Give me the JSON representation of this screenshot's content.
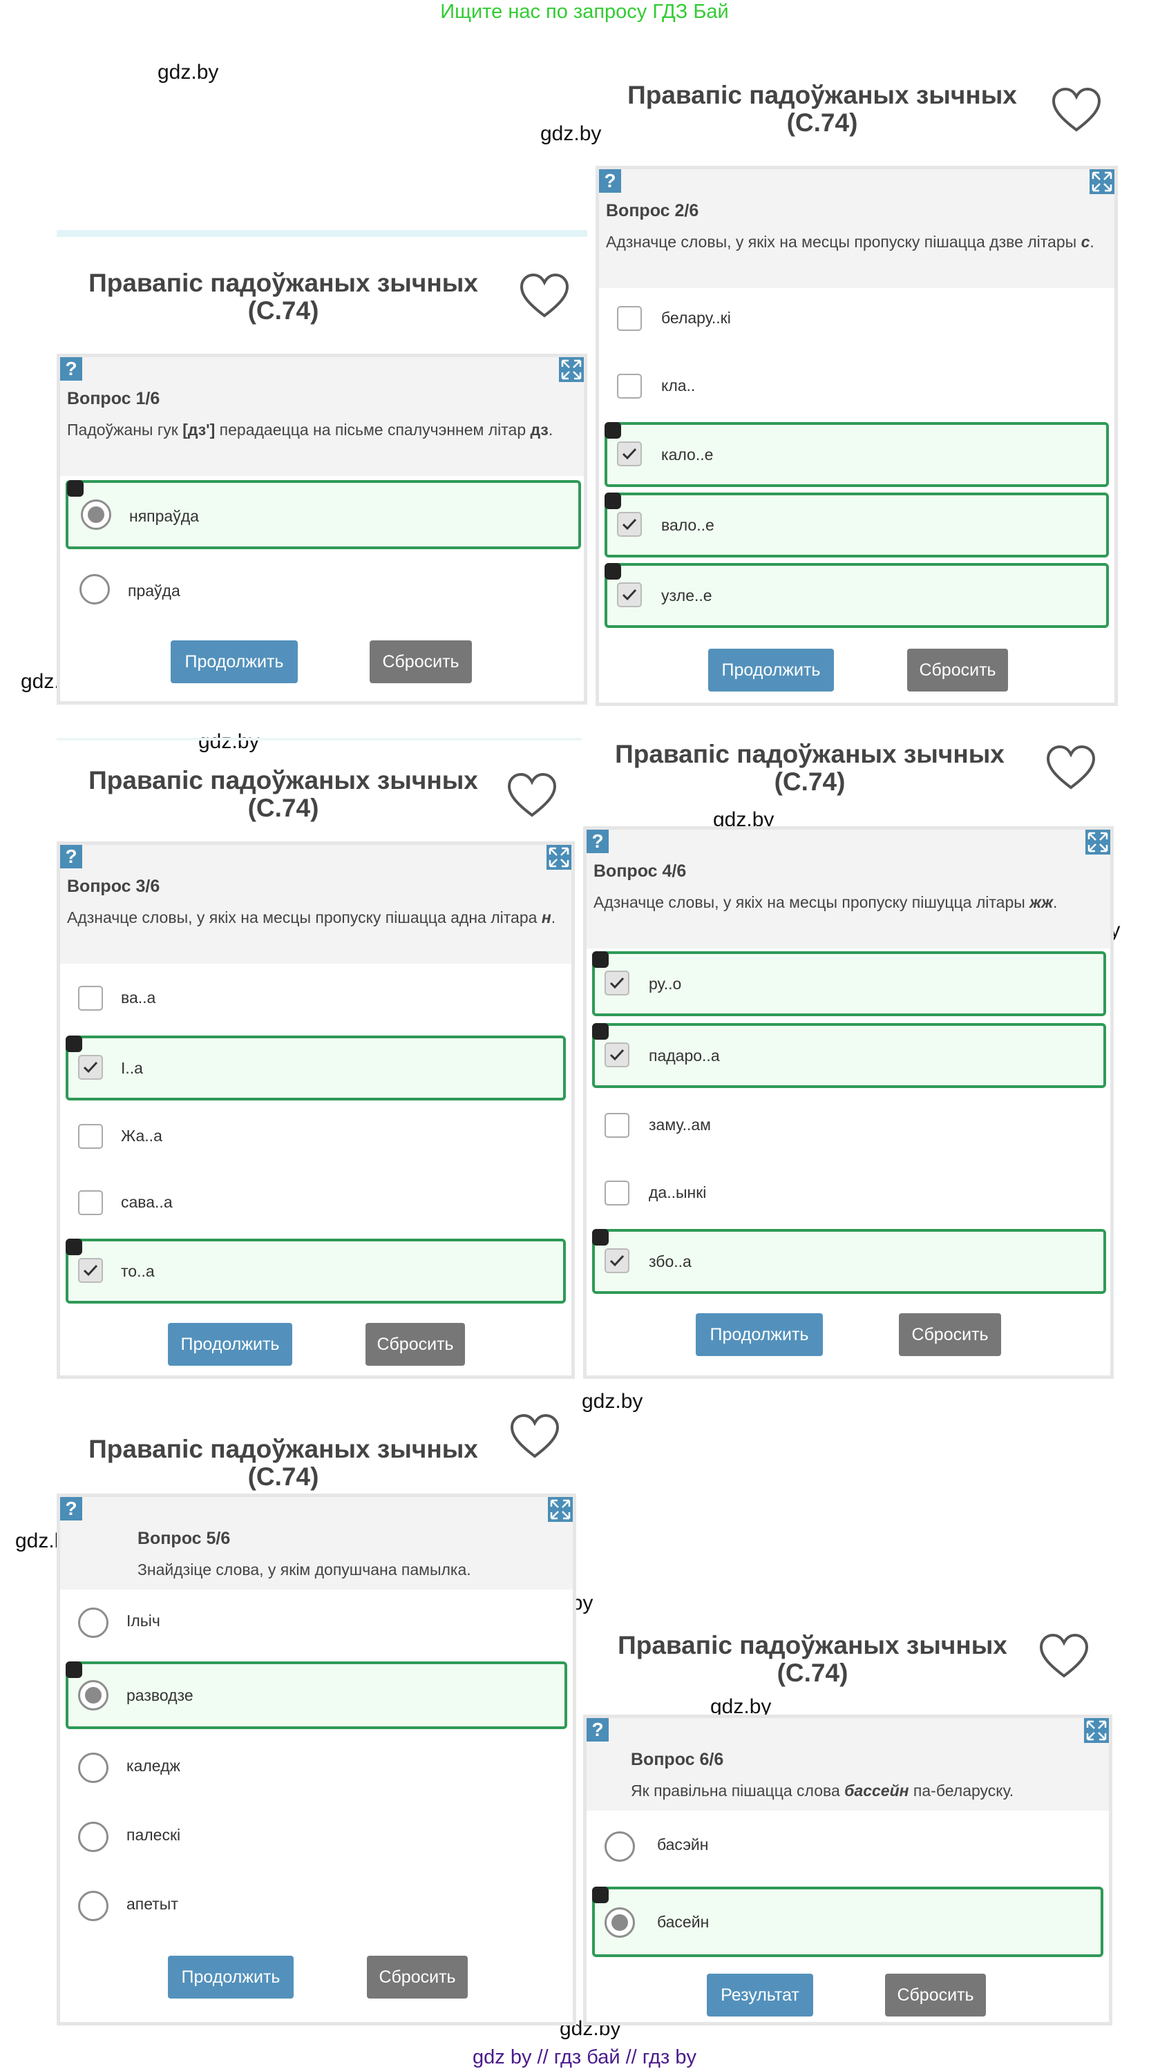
{
  "banner": "Ищите нас по запросу ГДЗ Бай",
  "watermark": "gdz.by",
  "footer": "gdz by  //  гдз бай  //  гдз by",
  "quiz_title_line1": "Правапіс падоўжаных зычных",
  "quiz_title_line2": "(С.74)",
  "help_label": "?",
  "buttons": {
    "continue": "Продолжить",
    "reset": "Сбросить",
    "result": "Результат"
  },
  "q1": {
    "num": "Вопрос 1/6",
    "text_a": "Падоўжаны гук ",
    "text_b": "[дз']",
    "text_c": " перадаецца на пісьме спалучэннем літар ",
    "text_d": "дз",
    "text_e": ".",
    "options": [
      {
        "label": "няпраўда",
        "selected": true
      },
      {
        "label": "праўда",
        "selected": false
      }
    ]
  },
  "q2": {
    "num": "Вопрос 2/6",
    "text_a": "Адзначце словы, у якіх на месцы пропуску пішацца дзве літары ",
    "text_b": "с",
    "text_c": ".",
    "options": [
      {
        "label": "белару..кі",
        "checked": false
      },
      {
        "label": "кла..",
        "checked": false
      },
      {
        "label": "кало..е",
        "checked": true
      },
      {
        "label": "вало..е",
        "checked": true
      },
      {
        "label": "узле..е",
        "checked": true
      }
    ]
  },
  "q3": {
    "num": "Вопрос 3/6",
    "text_a": "Адзначце словы, у якіх на месцы пропуску пішацца адна літара ",
    "text_b": "н",
    "text_c": ".",
    "options": [
      {
        "label": "ва..а",
        "checked": false
      },
      {
        "label": "І..а",
        "checked": true
      },
      {
        "label": "Жа..а",
        "checked": false
      },
      {
        "label": "сава..а",
        "checked": false
      },
      {
        "label": "то..а",
        "checked": true
      }
    ]
  },
  "q4": {
    "num": "Вопрос 4/6",
    "text_a": "Адзначце словы, у якіх на месцы пропуску пішуцца літары ",
    "text_b": "жж",
    "text_c": ".",
    "options": [
      {
        "label": "ру..о",
        "checked": true
      },
      {
        "label": "падаро..а",
        "checked": true
      },
      {
        "label": "заму..ам",
        "checked": false
      },
      {
        "label": "да..ынкі",
        "checked": false
      },
      {
        "label": "збо..а",
        "checked": true
      }
    ]
  },
  "q5": {
    "num": "Вопрос 5/6",
    "text": "Знайдзіце слова, у якім допушчана памылка.",
    "options": [
      {
        "label": "Ільіч",
        "selected": false
      },
      {
        "label": "разводзе",
        "selected": true
      },
      {
        "label": "каледж",
        "selected": false
      },
      {
        "label": "палескі",
        "selected": false
      },
      {
        "label": "апетыт",
        "selected": false
      }
    ]
  },
  "q6": {
    "num": "Вопрос 6/6",
    "text_a": "Як правільна пішацца слова ",
    "text_b": "бассейн",
    "text_c": " па-беларуску.",
    "options": [
      {
        "label": "басэйн",
        "selected": false
      },
      {
        "label": "басейн",
        "selected": true
      }
    ]
  }
}
